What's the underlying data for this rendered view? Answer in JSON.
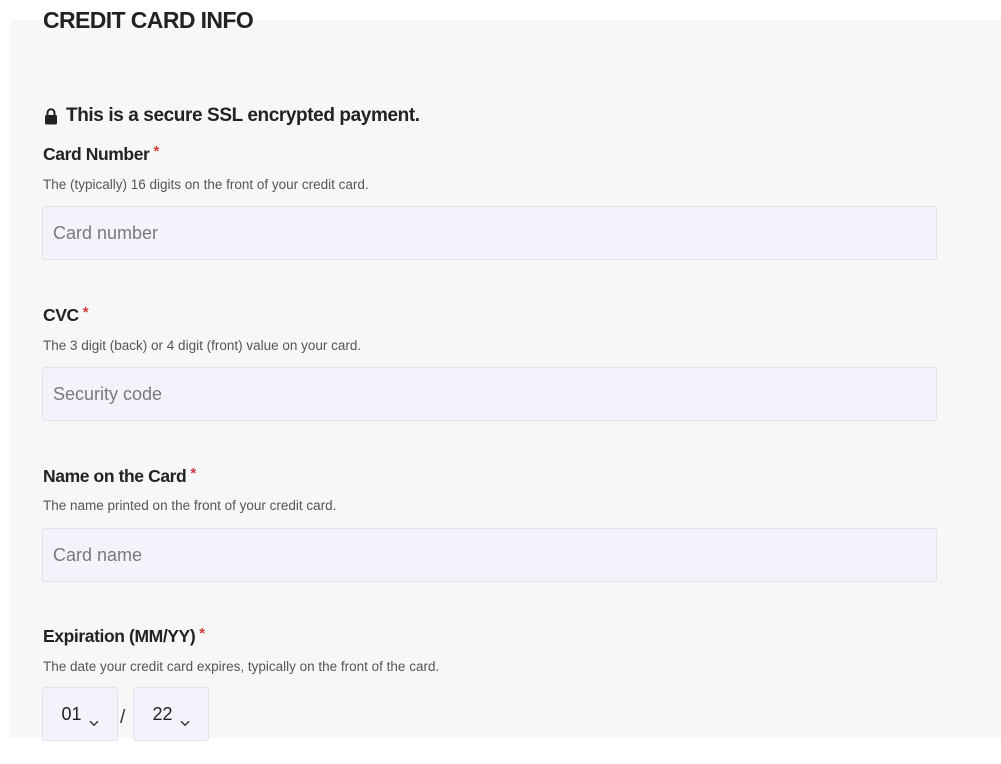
{
  "form": {
    "title": "CREDIT CARD INFO",
    "secure_notice": "This is a secure SSL encrypted payment.",
    "required_marker": "*",
    "fields": {
      "card_number": {
        "label": "Card Number",
        "help": "The (typically) 16 digits on the front of your credit card.",
        "placeholder": "Card number",
        "value": ""
      },
      "cvc": {
        "label": "CVC",
        "help": "The 3 digit (back) or 4 digit (front) value on your card.",
        "placeholder": "Security code",
        "value": ""
      },
      "card_name": {
        "label": "Name on the Card",
        "help": "The name printed on the front of your credit card.",
        "placeholder": "Card name",
        "value": ""
      },
      "expiration": {
        "label": "Expiration (MM/YY)",
        "help": "The date your credit card expires, typically on the front of the card.",
        "month_value": "01",
        "year_value": "22",
        "separator": "/"
      }
    }
  },
  "icons": {
    "secure": "lock-icon",
    "dropdown": "chevron-down-icon"
  },
  "colors": {
    "required": "#d33a3a",
    "input_background": "#f2f3fb",
    "panel_background": "#f7f7f7"
  }
}
